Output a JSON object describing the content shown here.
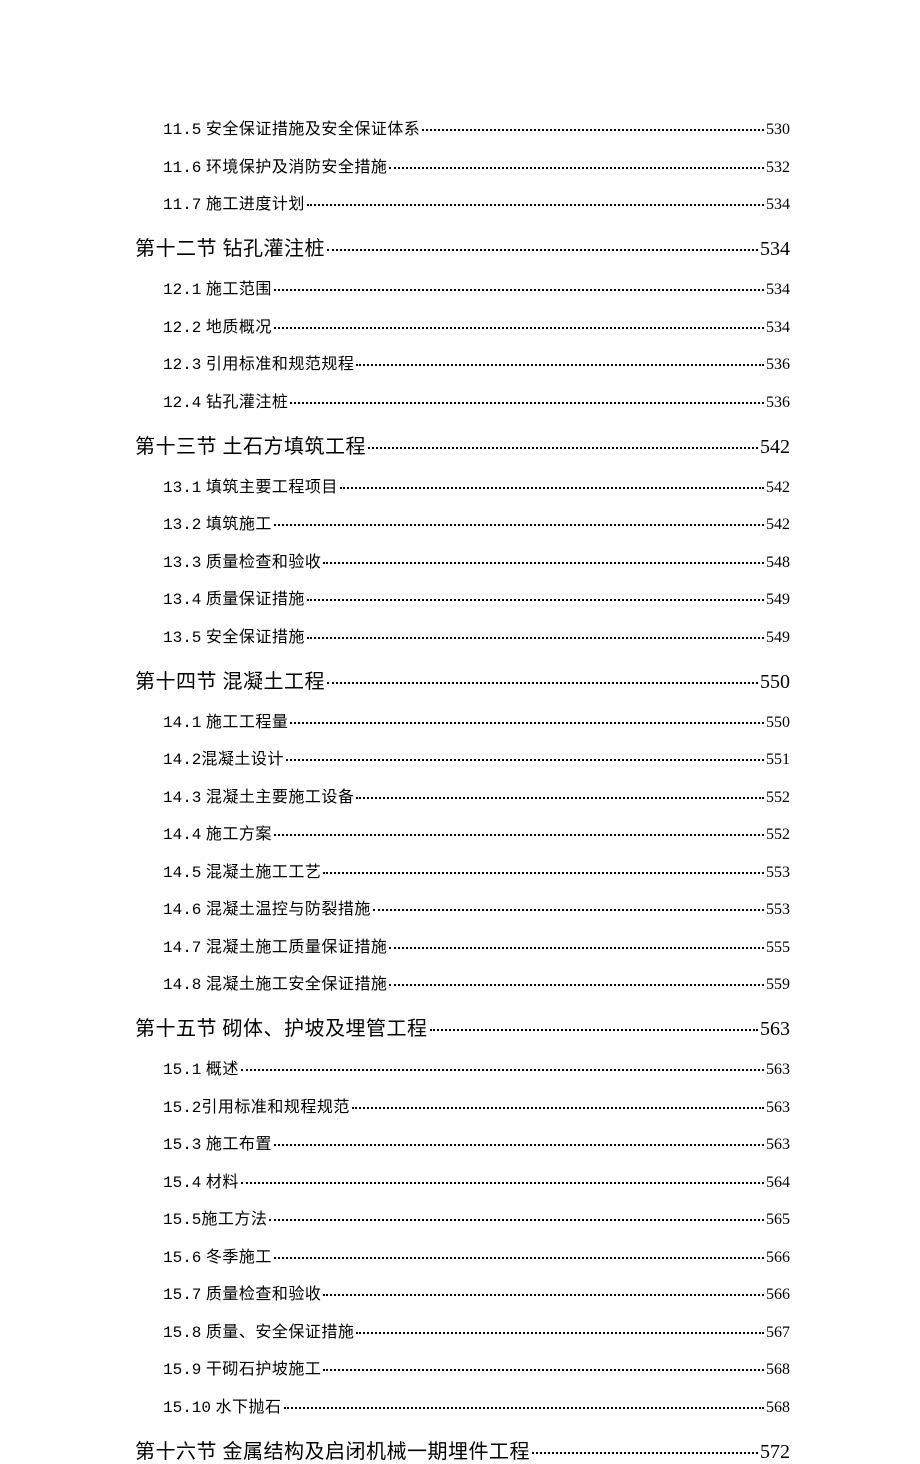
{
  "toc": [
    {
      "level": 2,
      "num": "11.5",
      "title": "安全保证措施及安全保证体系",
      "page": "530"
    },
    {
      "level": 2,
      "num": "11.6",
      "title": "环境保护及消防安全措施",
      "page": "532"
    },
    {
      "level": 2,
      "num": "11.7",
      "title": "施工进度计划",
      "page": "534"
    },
    {
      "level": 1,
      "num": "第十二节",
      "title": "钻孔灌注桩",
      "page": "534"
    },
    {
      "level": 2,
      "num": "12.1",
      "title": "施工范围",
      "page": "534"
    },
    {
      "level": 2,
      "num": "12.2",
      "title": "地质概况",
      "page": "534"
    },
    {
      "level": 2,
      "num": "12.3",
      "title": "引用标准和规范规程",
      "page": "536"
    },
    {
      "level": 2,
      "num": "12.4",
      "title": "钻孔灌注桩",
      "page": "536"
    },
    {
      "level": 1,
      "num": "第十三节",
      "title": "土石方填筑工程",
      "page": "542"
    },
    {
      "level": 2,
      "num": "13.1",
      "title": "填筑主要工程项目",
      "page": "542"
    },
    {
      "level": 2,
      "num": "13.2",
      "title": "填筑施工",
      "page": "542"
    },
    {
      "level": 2,
      "num": "13.3",
      "title": "质量检查和验收",
      "page": "548"
    },
    {
      "level": 2,
      "num": "13.4",
      "title": "质量保证措施",
      "page": "549"
    },
    {
      "level": 2,
      "num": "13.5",
      "title": "安全保证措施",
      "page": "549"
    },
    {
      "level": 1,
      "num": "第十四节",
      "title": "混凝土工程",
      "page": "550"
    },
    {
      "level": 2,
      "num": "14.1",
      "title": "施工工程量",
      "page": "550"
    },
    {
      "level": 2,
      "num": "14.2",
      "title": "混凝土设计",
      "page": "551",
      "nospace": true
    },
    {
      "level": 2,
      "num": "14.3",
      "title": "混凝土主要施工设备",
      "page": "552"
    },
    {
      "level": 2,
      "num": "14.4",
      "title": "施工方案",
      "page": "552"
    },
    {
      "level": 2,
      "num": "14.5",
      "title": "混凝土施工工艺",
      "page": "553"
    },
    {
      "level": 2,
      "num": "14.6",
      "title": "混凝土温控与防裂措施",
      "page": "553"
    },
    {
      "level": 2,
      "num": "14.7",
      "title": "混凝土施工质量保证措施",
      "page": "555"
    },
    {
      "level": 2,
      "num": "14.8",
      "title": "混凝土施工安全保证措施",
      "page": "559"
    },
    {
      "level": 1,
      "num": "第十五节",
      "title": "砌体、护坡及埋管工程",
      "page": "563"
    },
    {
      "level": 2,
      "num": "15.1",
      "title": "概述",
      "page": "563"
    },
    {
      "level": 2,
      "num": "15.2",
      "title": "引用标准和规程规范",
      "page": "563",
      "nospace": true
    },
    {
      "level": 2,
      "num": "15.3",
      "title": "施工布置",
      "page": "563"
    },
    {
      "level": 2,
      "num": "15.4",
      "title": "材料",
      "page": "564"
    },
    {
      "level": 2,
      "num": "15.5",
      "title": "施工方法",
      "page": "565",
      "nospace": true
    },
    {
      "level": 2,
      "num": "15.6",
      "title": "冬季施工",
      "page": "566"
    },
    {
      "level": 2,
      "num": "15.7",
      "title": "质量检查和验收",
      "page": "566"
    },
    {
      "level": 2,
      "num": "15.8",
      "title": "质量、安全保证措施",
      "page": "567"
    },
    {
      "level": 2,
      "num": "15.9",
      "title": "干砌石护坡施工",
      "page": "568"
    },
    {
      "level": 2,
      "num": "15.10",
      "title": "水下抛石",
      "page": "568"
    },
    {
      "level": 1,
      "num": "第十六节",
      "title": "金属结构及启闭机械一期埋件工程",
      "page": "572"
    }
  ]
}
